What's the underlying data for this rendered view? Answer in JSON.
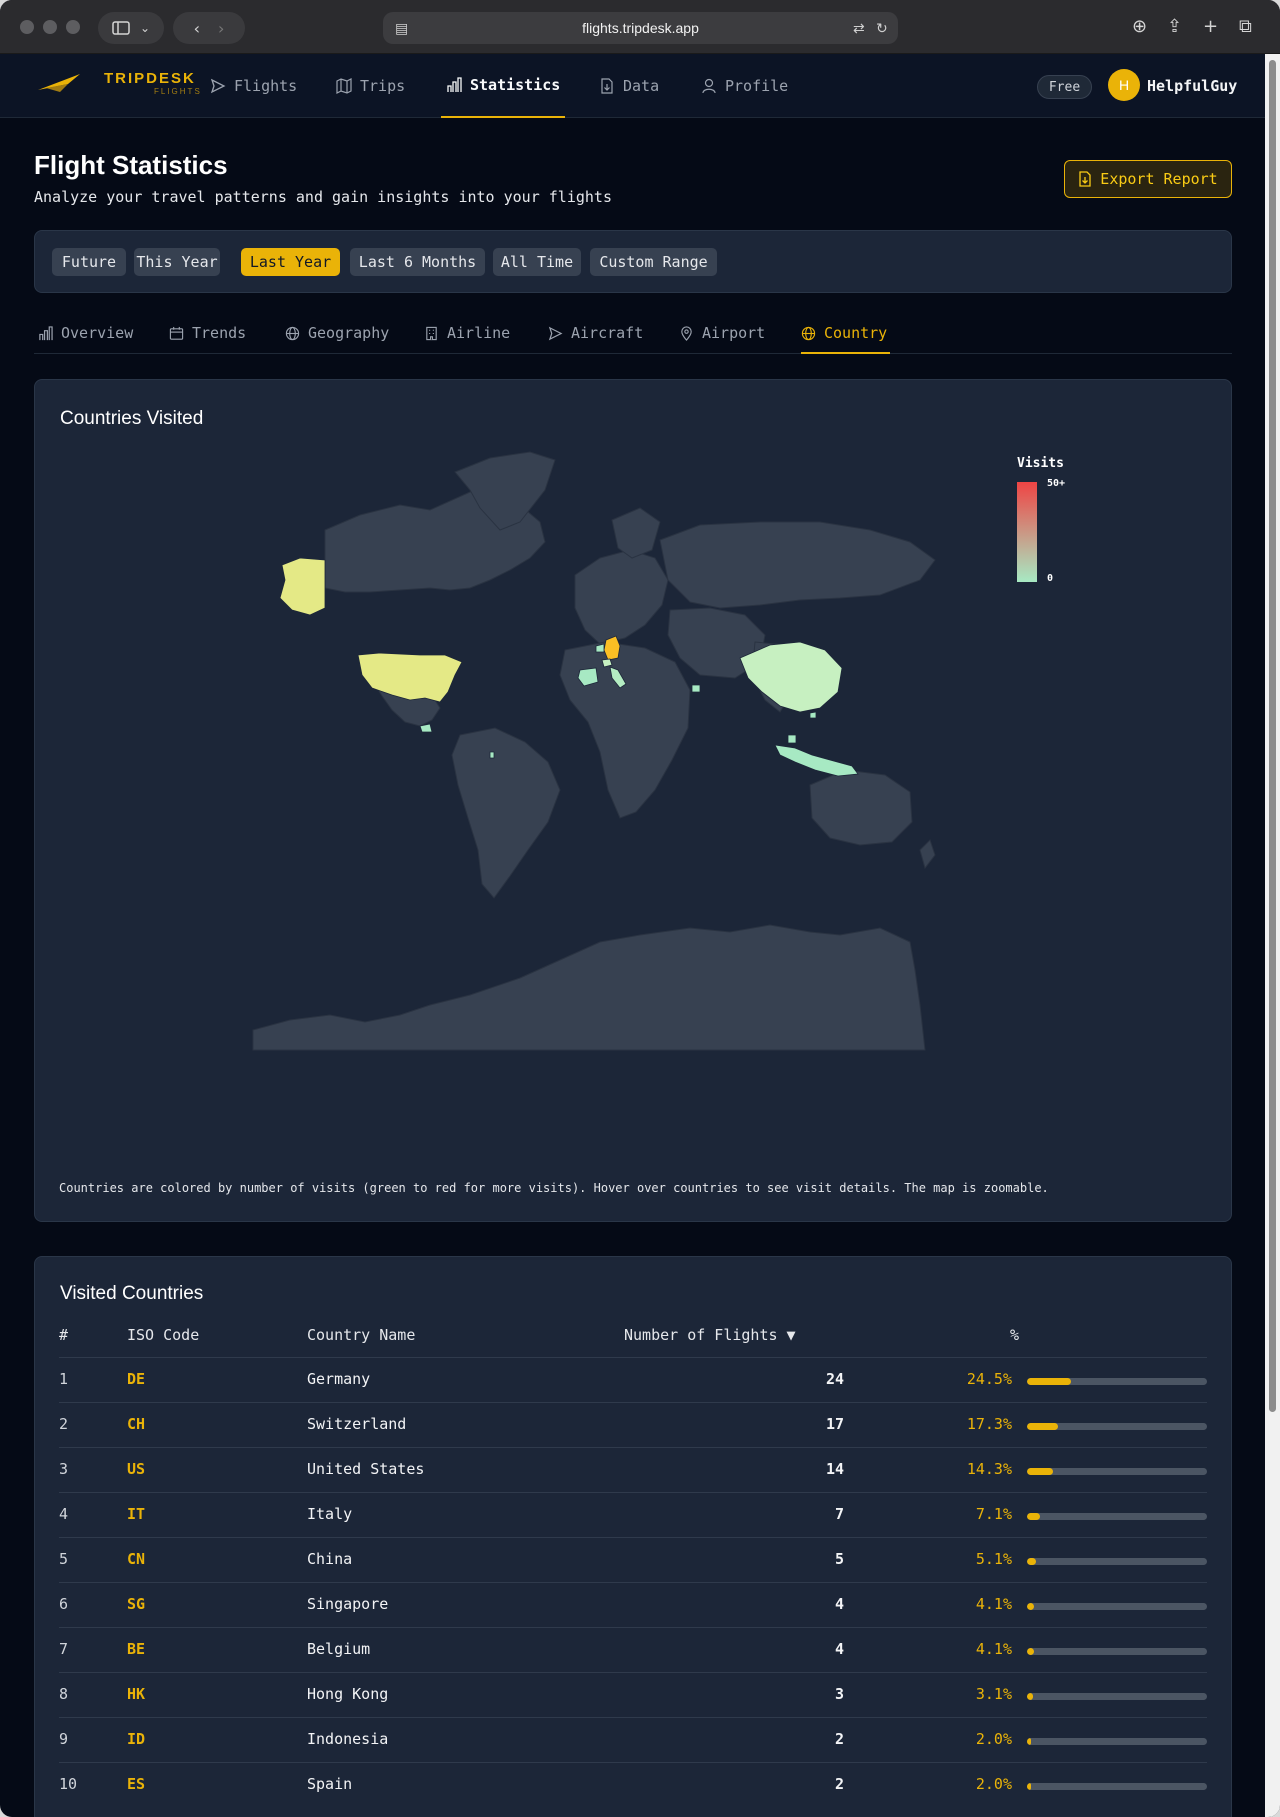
{
  "browser": {
    "url": "flights.tripdesk.app"
  },
  "brand": {
    "name": "TRIPDESK",
    "sub": "FLIGHTS",
    "accent": "#eab308"
  },
  "nav": {
    "items": [
      {
        "label": "Flights",
        "icon": "paper-plane-icon"
      },
      {
        "label": "Trips",
        "icon": "map-icon"
      },
      {
        "label": "Statistics",
        "icon": "bar-chart-icon",
        "active": true
      },
      {
        "label": "Data",
        "icon": "file-icon"
      },
      {
        "label": "Profile",
        "icon": "user-icon"
      }
    ],
    "plan_badge": "Free",
    "avatar_initial": "H",
    "username": "HelpfulGuy"
  },
  "header": {
    "title": "Flight Statistics",
    "subtitle": "Analyze your travel patterns and gain insights into your flights",
    "export_label": "Export Report"
  },
  "filters": {
    "items": [
      "Future",
      "This Year",
      "Last Year",
      "Last 6 Months",
      "All Time",
      "Custom Range"
    ],
    "active": "Last Year"
  },
  "tabs": {
    "items": [
      "Overview",
      "Trends",
      "Geography",
      "Airline",
      "Aircraft",
      "Airport",
      "Country"
    ],
    "active": "Country"
  },
  "map": {
    "title": "Countries Visited",
    "legend_title": "Visits",
    "legend_max": "50+",
    "legend_min": "0",
    "note": "Countries are colored by number of visits (green to red for more visits). Hover over countries to see visit details. The map is zoomable.",
    "colors": {
      "ocean": "#1c2638",
      "land": "#374151",
      "low": "#a7e9c3",
      "mid": "#e4e986",
      "high": "#fbbf24"
    }
  },
  "table": {
    "title": "Visited Countries",
    "columns": [
      "#",
      "ISO Code",
      "Country Name",
      "Number of Flights ▼",
      "%"
    ],
    "rows": [
      {
        "n": "1",
        "iso": "DE",
        "name": "Germany",
        "flights": "24",
        "pct": "24.5%",
        "share": 0.245
      },
      {
        "n": "2",
        "iso": "CH",
        "name": "Switzerland",
        "flights": "17",
        "pct": "17.3%",
        "share": 0.173
      },
      {
        "n": "3",
        "iso": "US",
        "name": "United States",
        "flights": "14",
        "pct": "14.3%",
        "share": 0.143
      },
      {
        "n": "4",
        "iso": "IT",
        "name": "Italy",
        "flights": "7",
        "pct": "7.1%",
        "share": 0.071
      },
      {
        "n": "5",
        "iso": "CN",
        "name": "China",
        "flights": "5",
        "pct": "5.1%",
        "share": 0.051
      },
      {
        "n": "6",
        "iso": "SG",
        "name": "Singapore",
        "flights": "4",
        "pct": "4.1%",
        "share": 0.041
      },
      {
        "n": "7",
        "iso": "BE",
        "name": "Belgium",
        "flights": "4",
        "pct": "4.1%",
        "share": 0.041
      },
      {
        "n": "8",
        "iso": "HK",
        "name": "Hong Kong",
        "flights": "3",
        "pct": "3.1%",
        "share": 0.031
      },
      {
        "n": "9",
        "iso": "ID",
        "name": "Indonesia",
        "flights": "2",
        "pct": "2.0%",
        "share": 0.02
      },
      {
        "n": "10",
        "iso": "ES",
        "name": "Spain",
        "flights": "2",
        "pct": "2.0%",
        "share": 0.02
      }
    ]
  }
}
